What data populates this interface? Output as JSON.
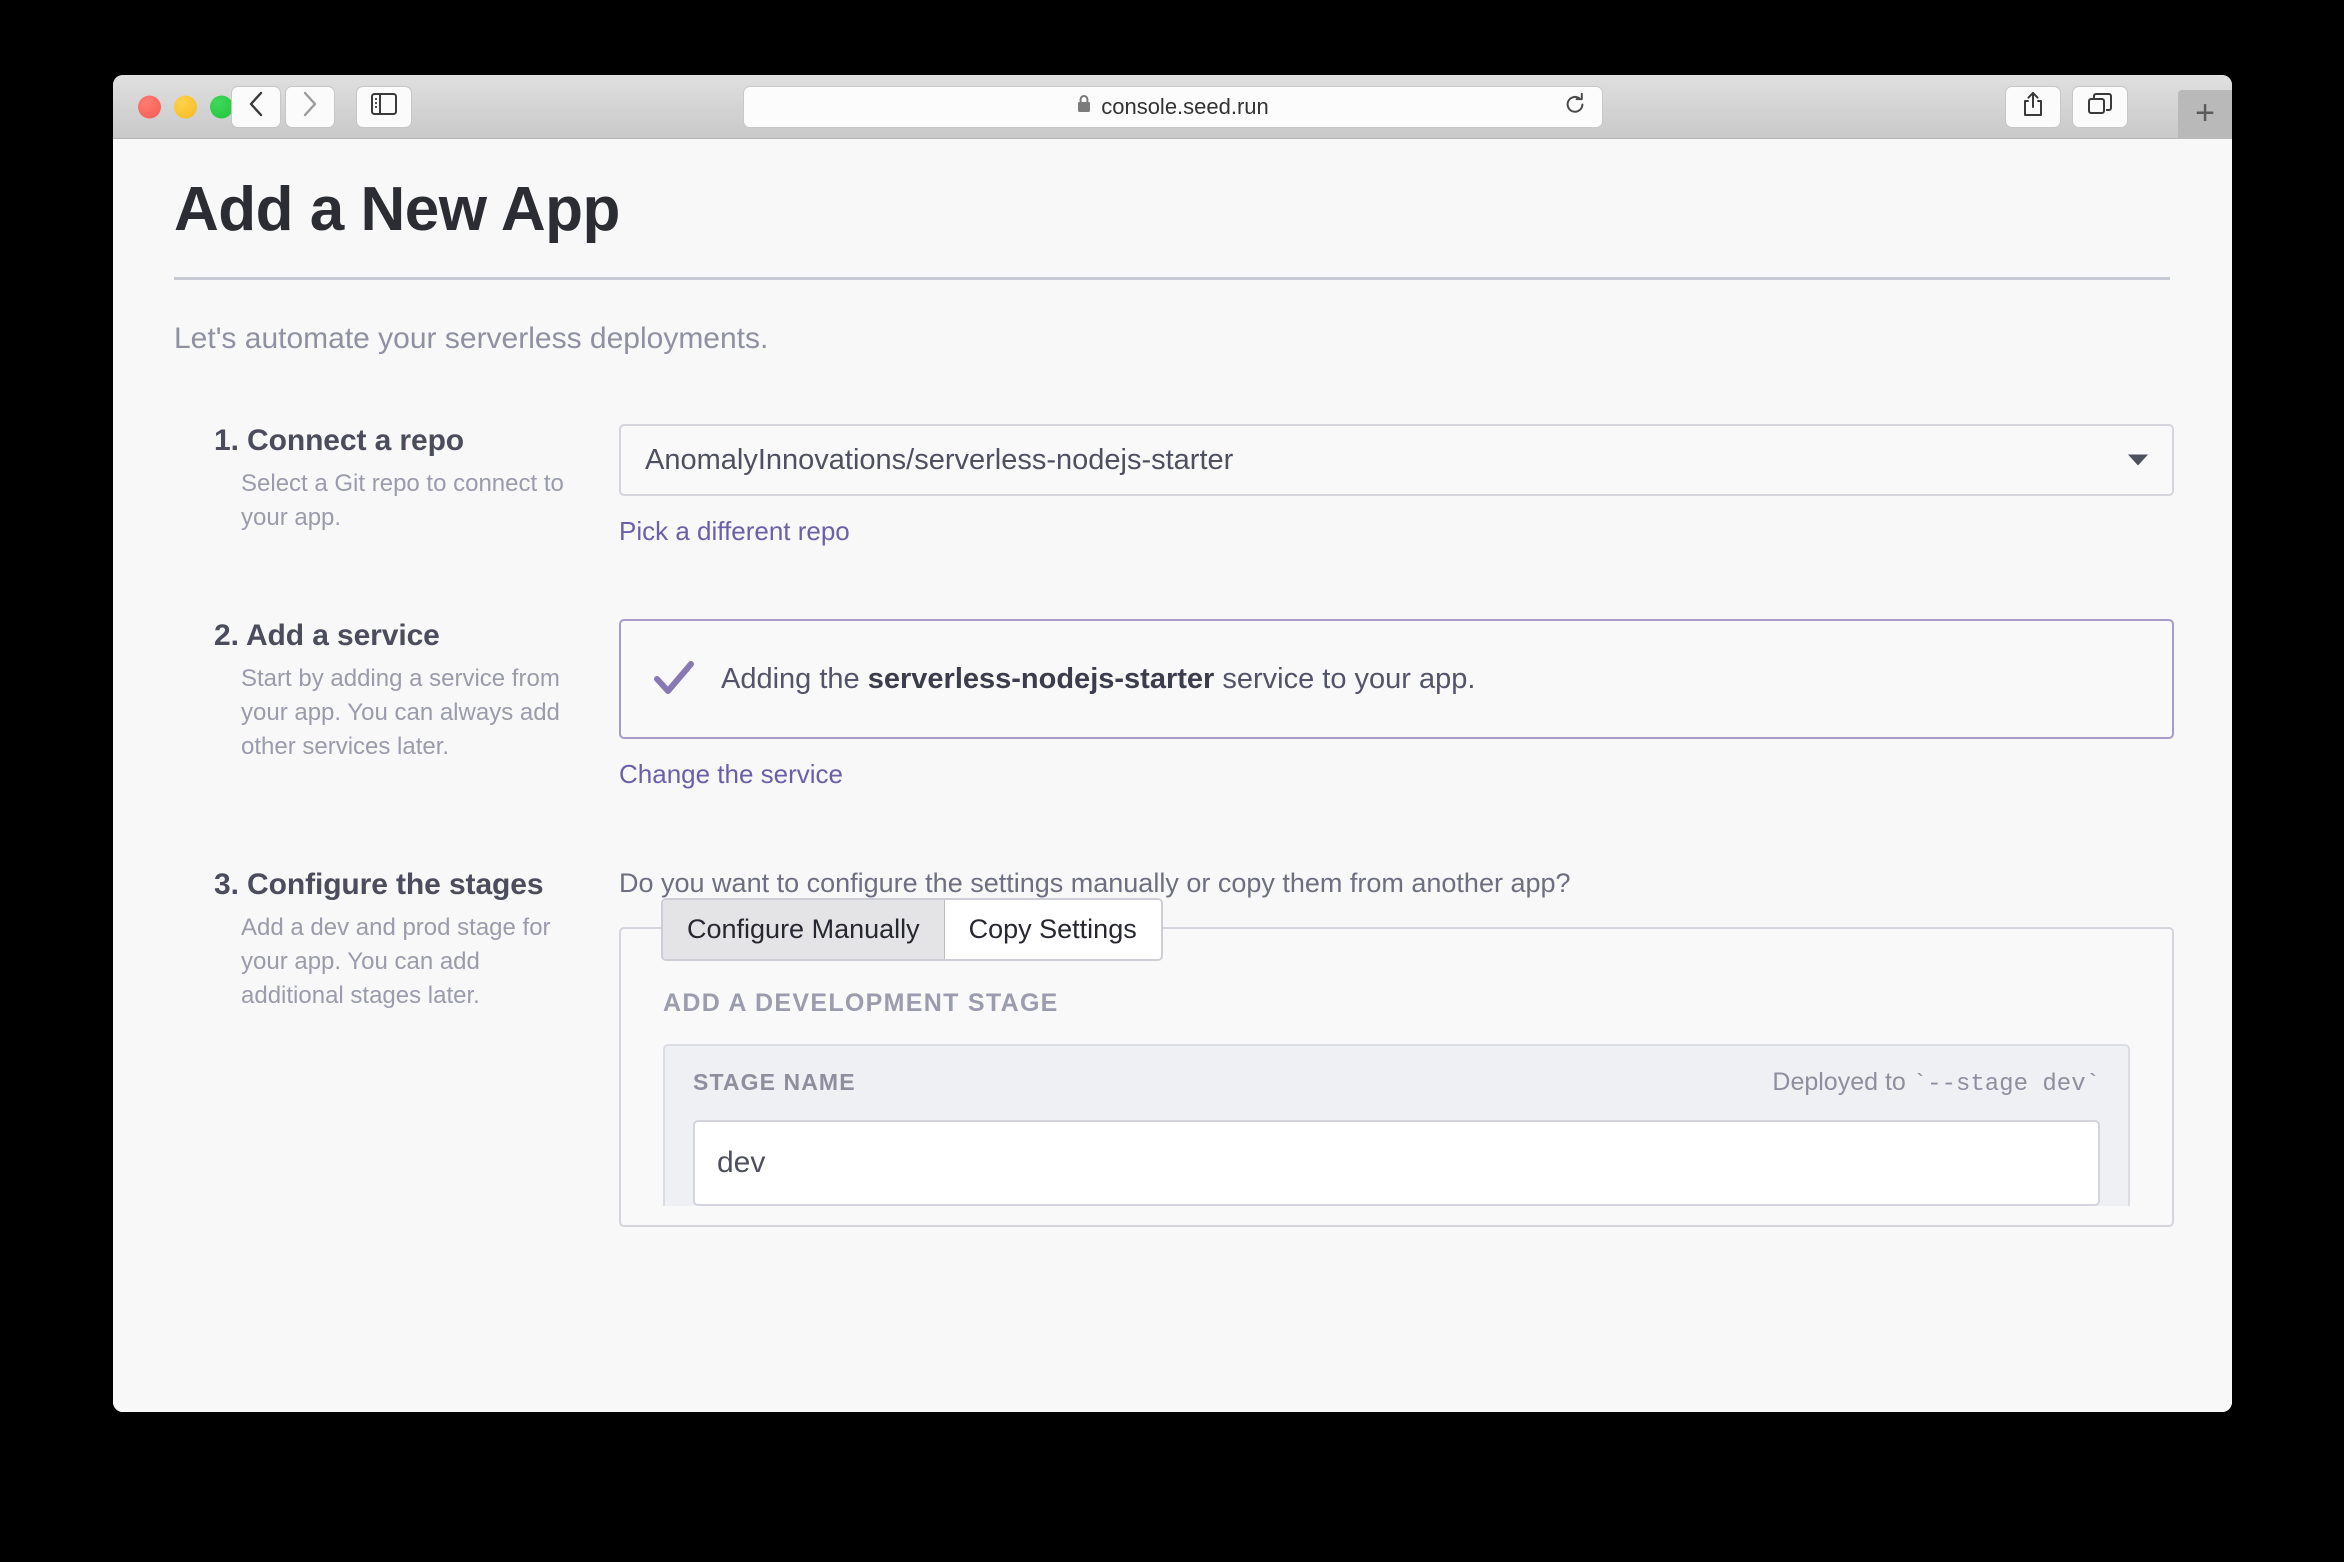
{
  "browser": {
    "url": "console.seed.run",
    "lock_icon": "lock-icon",
    "reload_icon": "reload-icon",
    "back_icon": "chevron-left-icon",
    "forward_icon": "chevron-right-icon",
    "sidebar_icon": "sidebar-icon",
    "share_icon": "share-icon",
    "tabs_icon": "tabs-icon",
    "new_tab_label": "+"
  },
  "page": {
    "title": "Add a New App",
    "subtitle": "Let's automate your serverless deployments."
  },
  "steps": [
    {
      "title": "1. Connect a repo",
      "description": "Select a Git repo to connect to your app."
    },
    {
      "title": "2. Add a service",
      "description": "Start by adding a service from your app. You can always add other services later."
    },
    {
      "title": "3. Configure the stages",
      "description": "Add a dev and prod stage for your app. You can add additional stages later."
    }
  ],
  "connect_repo": {
    "selected_repo": "AnomalyInnovations/serverless-nodejs-starter",
    "change_link": "Pick a different repo",
    "caret_icon": "chevron-down-icon"
  },
  "add_service": {
    "check_icon": "checkmark-icon",
    "message_prefix": "Adding the ",
    "service_name": "serverless-nodejs-starter",
    "message_suffix": " service to your app.",
    "change_link": "Change the service"
  },
  "configure_stages": {
    "question": "Do you want to configure the settings manually or copy them from another app?",
    "tabs": [
      {
        "label": "Configure Manually",
        "active": true
      },
      {
        "label": "Copy Settings",
        "active": false
      }
    ],
    "section_title": "ADD A DEVELOPMENT STAGE",
    "stage_name_label": "STAGE NAME",
    "deployed_to_prefix": "Deployed to ",
    "deployed_to_code": "`--stage dev`",
    "stage_name_value": "dev"
  },
  "colors": {
    "accent_purple": "#6c5fa8",
    "panel_border_purple": "#a79bc9",
    "text_dark": "#2b2d33",
    "text_muted": "#9a9bab",
    "page_bg": "#f8f8f9"
  }
}
